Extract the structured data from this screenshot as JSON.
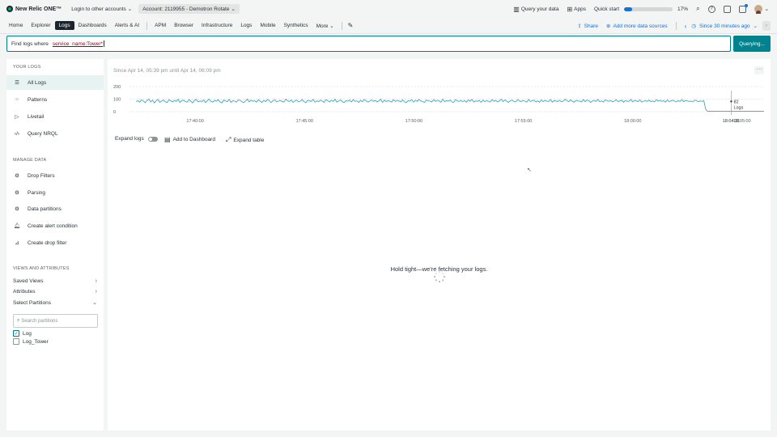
{
  "topbar": {
    "logo_text": "New Relic ONE™",
    "login_label": "Login to other accounts",
    "account_label": "Account: 2119955 - Demotron Rotate",
    "query_data_label": "Query your data",
    "apps_label": "Apps",
    "quick_start_label": "Quick start",
    "quick_start_percent_label": "17%",
    "quick_start_percent": 17
  },
  "nav": {
    "items": [
      "Home",
      "Explorer",
      "Logs",
      "Dashboards",
      "Alerts & AI",
      "APM",
      "Browser",
      "Infrastructure",
      "Logs",
      "Mobile",
      "Synthetics",
      "More"
    ],
    "active_index": 2,
    "share_label": "Share",
    "add_sources_label": "Add more data sources",
    "time_label": "Since 30 minutes ago"
  },
  "query": {
    "prefix": "Find logs where",
    "value": "service_name:Tower*",
    "button_label": "Querying..."
  },
  "sidebar": {
    "your_logs_title": "YOUR LOGS",
    "your_logs": [
      {
        "label": "All Logs",
        "icon": "list-icon"
      },
      {
        "label": "Patterns",
        "icon": "patterns-icon"
      },
      {
        "label": "Livetail",
        "icon": "play-icon"
      },
      {
        "label": "Query NRQL",
        "icon": "code-icon"
      }
    ],
    "manage_title": "MANAGE DATA",
    "manage": [
      {
        "label": "Drop Filters",
        "icon": "gear-icon"
      },
      {
        "label": "Parsing",
        "icon": "gear-icon"
      },
      {
        "label": "Data partitions",
        "icon": "gear-icon"
      },
      {
        "label": "Create alert condition",
        "icon": "bell-icon"
      },
      {
        "label": "Create drop filter",
        "icon": "drop-filter-icon"
      }
    ],
    "views_title": "VIEWS AND ATTRIBUTES",
    "saved_views_label": "Saved Views",
    "attributes_label": "Attributes",
    "select_partitions_label": "Select Partitions",
    "search_placeholder": "Search partitions",
    "partitions": [
      {
        "label": "Log",
        "checked": true
      },
      {
        "label": "Log_Tower",
        "checked": false
      }
    ]
  },
  "main": {
    "since_text": "Since Apr 14, 05:39 pm until Apr 14, 06:09 pm",
    "expand_logs_label": "Expand logs",
    "add_dashboard_label": "Add to Dashboard",
    "expand_table_label": "Expand table",
    "loading_text": "Hold tight—we're fetching your logs.",
    "tooltip_value": "82",
    "tooltip_label": "Logs",
    "cursor_time_label": "18:04:31"
  },
  "chart_data": {
    "type": "line",
    "title": "",
    "xlabel": "",
    "ylabel": "",
    "y_ticks": [
      "0",
      "100",
      "200"
    ],
    "ylim": [
      0,
      200
    ],
    "x_ticks": [
      "17:40:00",
      "17:45:00",
      "17:50:00",
      "17:55:00",
      "18:00:00",
      "18:05:00"
    ],
    "x_range_minutes": [
      17.0,
      46.0
    ],
    "grid": true,
    "color": "#3fa8b8",
    "series": [
      {
        "name": "Logs",
        "values": [
          80,
          88,
          76,
          95,
          85,
          72,
          90,
          100,
          78,
          92,
          70,
          86,
          98,
          75,
          84,
          94,
          80,
          72,
          96,
          86,
          78,
          90,
          82,
          100,
          74,
          88,
          92,
          80,
          76,
          96,
          84,
          70,
          90,
          98,
          78,
          86,
          80,
          94,
          72,
          88,
          100,
          82,
          76,
          90,
          84,
          96,
          78,
          70,
          92,
          86,
          80,
          98,
          74,
          88,
          84,
          76,
          94,
          90,
          80,
          72,
          86,
          100,
          78,
          92,
          82,
          88,
          76,
          96,
          84,
          74,
          90,
          80,
          98,
          86,
          72,
          88,
          94,
          78,
          84,
          90,
          82,
          76,
          100,
          88,
          80,
          94,
          74,
          86,
          92,
          78,
          84,
          96,
          80,
          72,
          90,
          88,
          82,
          98,
          76,
          86,
          80,
          92,
          84,
          74,
          96,
          88,
          78,
          90,
          82,
          100,
          76,
          86,
          94,
          80,
          72,
          88,
          84,
          92,
          78,
          96,
          82,
          86,
          74,
          90,
          80,
          98,
          88,
          76,
          84,
          94,
          82,
          90,
          78,
          86,
          100,
          74,
          92,
          80,
          88,
          84,
          76,
          96,
          82,
          90,
          86,
          78,
          94,
          80,
          72,
          88,
          84,
          96,
          76,
          90,
          82,
          98,
          86,
          80,
          74,
          92,
          88,
          84,
          78,
          96,
          82,
          90,
          86,
          76,
          100,
          80,
          88,
          84,
          92,
          78,
          74,
          96,
          86,
          82,
          90,
          80,
          88,
          76,
          94,
          84,
          98,
          78,
          86,
          82,
          90,
          74,
          92,
          80,
          88,
          84,
          76,
          96,
          82,
          90,
          78,
          86,
          100,
          80,
          94,
          84,
          74,
          88,
          92,
          82,
          78,
          96,
          86,
          80,
          90,
          84,
          76,
          98,
          82,
          88,
          92,
          78,
          86,
          74,
          94,
          80,
          90,
          84,
          82,
          96,
          76,
          88,
          86,
          80,
          92,
          78,
          84,
          100,
          88,
          80,
          94,
          82,
          76,
          90,
          86,
          84,
          78,
          96,
          80,
          92,
          88,
          74,
          84,
          90,
          82,
          98,
          80,
          86,
          76,
          94,
          88,
          82,
          90,
          78,
          84,
          96,
          80,
          86,
          92,
          76,
          88,
          84,
          82,
          98,
          78,
          90,
          86,
          80,
          94,
          76,
          84,
          88,
          82,
          92,
          80,
          86,
          78,
          96,
          84,
          90,
          82,
          88,
          76,
          94,
          80,
          86,
          92,
          84,
          78,
          88,
          82,
          96,
          80,
          90,
          86,
          82,
          84,
          78,
          92,
          88,
          80,
          86,
          82,
          88,
          20,
          4,
          4,
          4,
          4,
          4,
          4,
          4,
          4,
          4,
          4,
          4,
          4,
          4,
          4,
          4,
          4,
          4,
          4,
          4,
          4,
          4,
          4,
          4,
          4,
          4,
          4,
          4,
          4,
          4,
          4,
          4,
          4
        ]
      }
    ]
  },
  "colors": {
    "teal": "#00838f",
    "line": "#3fa8b8",
    "link": "#0c74df",
    "query_text": "#a2001e"
  }
}
